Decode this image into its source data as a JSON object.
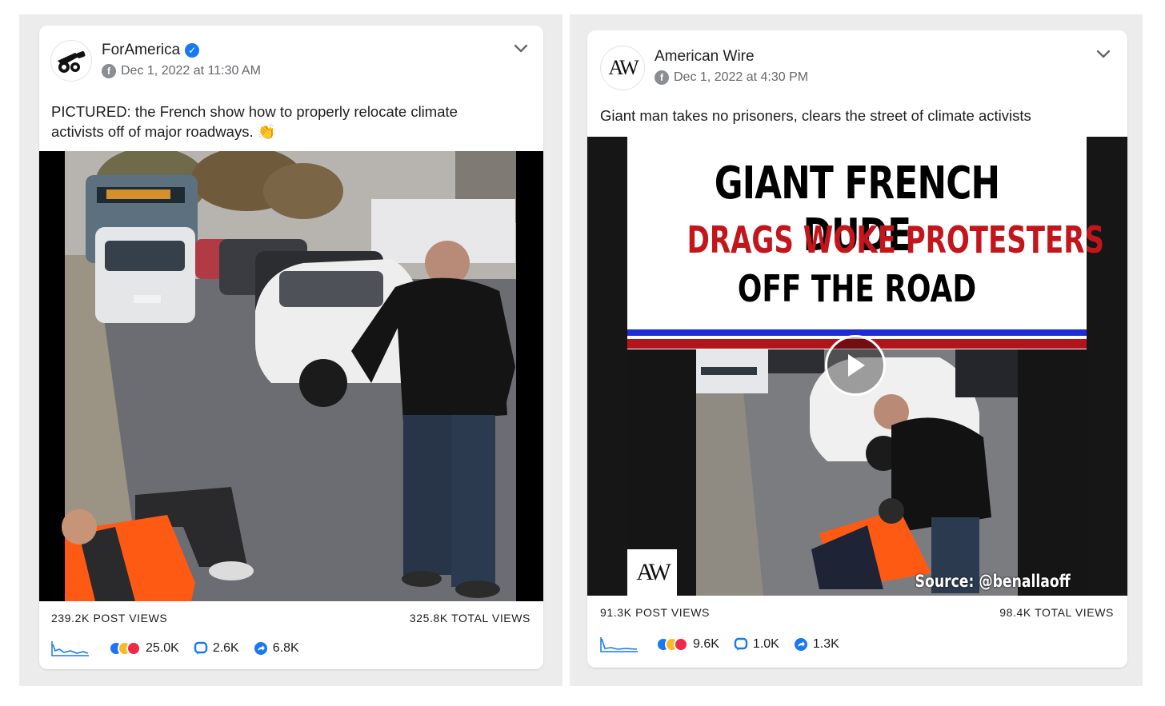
{
  "posts": [
    {
      "page_name": "ForAmerica",
      "verified": true,
      "date": "Dec 1, 2022 at 11:30 AM",
      "text": "PICTURED: the French show how to properly relocate climate activists off of major roadways. 👏",
      "post_views": "239.2K POST VIEWS",
      "total_views": "325.8K TOTAL VIEWS",
      "reactions": "25.0K",
      "comments": "2.6K",
      "shares": "6.8K",
      "avatar_icon": "cannon-icon"
    },
    {
      "page_name": "American Wire",
      "verified": false,
      "date": "Dec 1, 2022 at 4:30 PM",
      "text": "Giant man takes no prisoners, clears the street of climate activists",
      "post_views": "91.3K POST VIEWS",
      "total_views": "98.4K TOTAL VIEWS",
      "reactions": "9.6K",
      "comments": "1.0K",
      "shares": "1.3K",
      "avatar_logo": "AW",
      "thumbnail": {
        "headline_line1": "GIANT FRENCH DUDE",
        "headline_line2": "DRAGS WOKE PROTESTERS",
        "headline_line3": "OFF THE ROAD",
        "source": "Source: @benallaoff",
        "watermark": "AW"
      }
    }
  ],
  "colors": {
    "facebook_blue": "#1877f2",
    "headline_red": "#c3161c",
    "flag_blue": "#1e2bd6",
    "vest_orange": "#ff5a14"
  }
}
